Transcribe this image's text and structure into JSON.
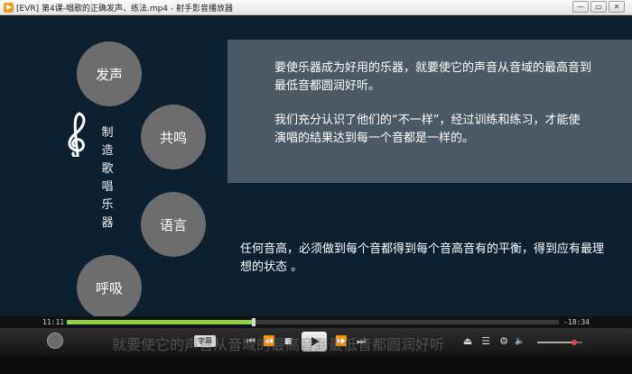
{
  "window": {
    "title": "[EVR] 第4课-唱歌的正确发声、练法.mp4 - 射手影音播放器",
    "minimize": "—",
    "restore": "▭",
    "close": "✕"
  },
  "slide": {
    "circles": [
      "发声",
      "共鸣",
      "语言",
      "呼吸"
    ],
    "vertical_title": [
      "制",
      "造",
      "歌",
      "唱",
      "乐",
      "器"
    ],
    "panel_paragraphs": [
      "要使乐器成为好用的乐器，就要使它的声音从音域的最高音到最低音都圆润好听。",
      "我们充分认识了他们的“不一样”，经过训练和练习，才能使演唱的结果达到每一个音都是一样的。"
    ],
    "lower_paragraph": "任何音高，必须做到每个音都得到每个音高音有的平衡，得到应有最理想的状态 。"
  },
  "player": {
    "time_elapsed": "11:11",
    "time_remaining": "-18:34",
    "progress": 0.38,
    "volume": 0.82,
    "subtitle_button": "字幕",
    "caption": "就要使它的声音从音域的最高音到最低音都圆润好听",
    "buttons": {
      "prev_chapter": "⏮",
      "rewind": "⏪",
      "stop": "■",
      "forward": "⏩",
      "next_chapter": "⏭",
      "open": "⏏",
      "playlist": "☰",
      "settings": "⚙",
      "volume": "🔈"
    }
  },
  "colors": {
    "video_bg": "#0c2030",
    "panel_bg": "#4a5963",
    "circle_bg": "#6d6d6d",
    "progress_fill": "#8ed245"
  }
}
